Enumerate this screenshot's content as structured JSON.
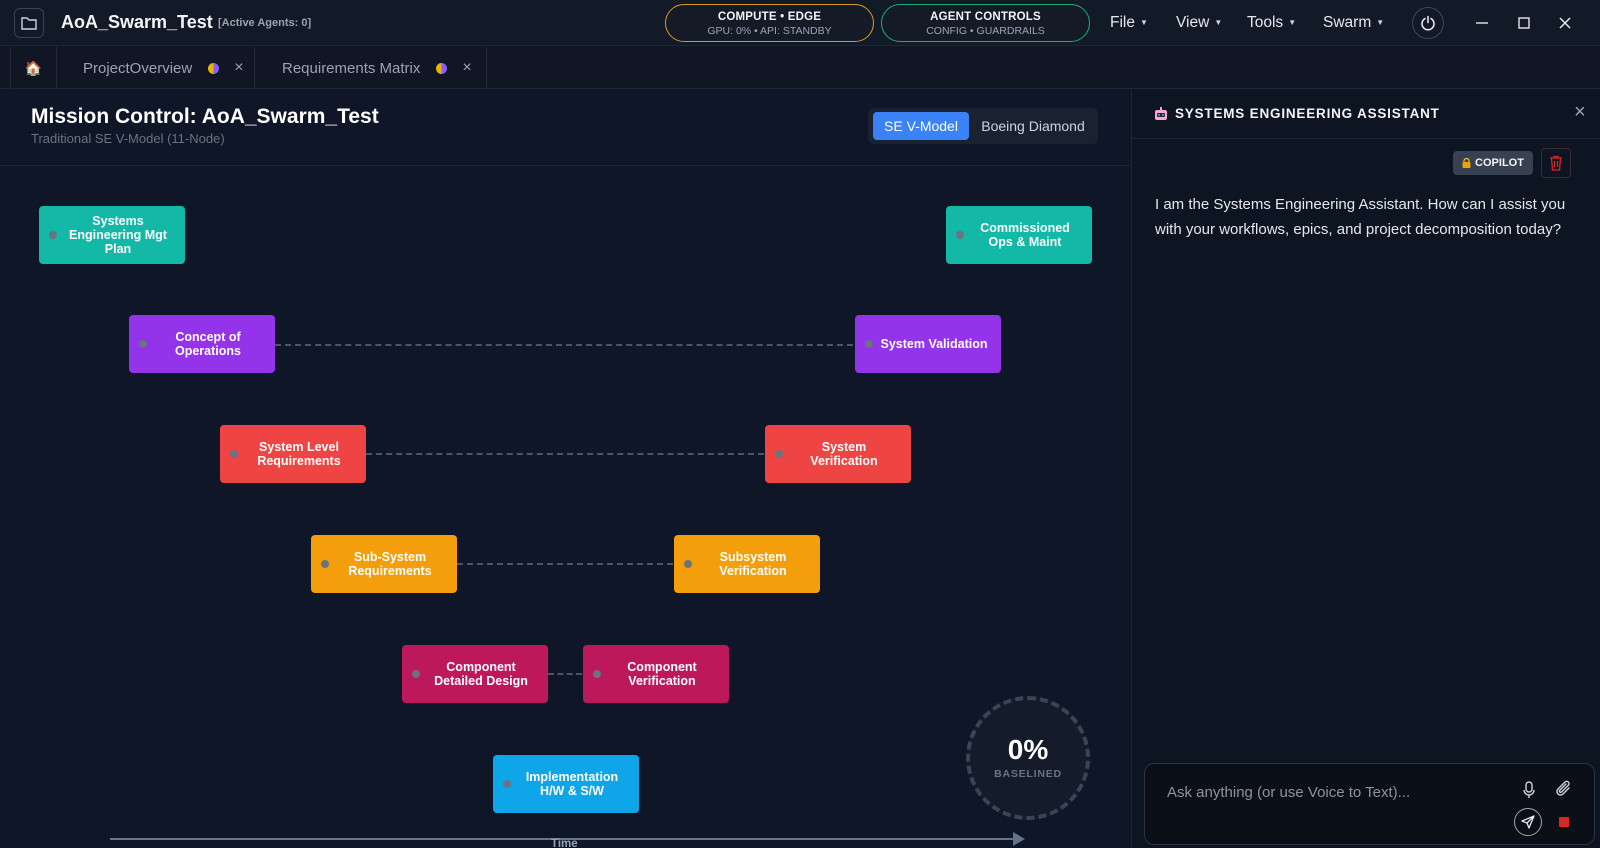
{
  "titlebar": {
    "app_title": "AoA_Swarm_Test",
    "active_agents": "[Active Agents: 0]",
    "compute_pill": {
      "line1": "COMPUTE • EDGE",
      "line2": "GPU: 0% • API: STANDBY",
      "accent": "#d69a2a"
    },
    "agent_pill": {
      "line1": "AGENT CONTROLS",
      "line2": "CONFIG • GUARDRAILS",
      "accent": "#22a77a"
    },
    "menus": [
      "File",
      "View",
      "Tools",
      "Swarm"
    ],
    "icons": [
      "folder-icon",
      "power-icon",
      "minimize-icon",
      "maximize-icon",
      "close-icon"
    ]
  },
  "tabs": [
    {
      "label": "ProjectOverview"
    },
    {
      "label": "Requirements Matrix"
    }
  ],
  "main": {
    "title": "Mission Control: AoA_Swarm_Test",
    "subtitle": "Traditional SE V-Model (11-Node)",
    "view_toggle": {
      "active": "SE V-Model",
      "inactive": "Boeing Diamond",
      "active_color": "#3b82f6"
    },
    "nodes": [
      {
        "label": "Systems Engineering Mgt Plan",
        "color": "#14b8a6"
      },
      {
        "label": "Concept of Operations",
        "color": "#9333ea"
      },
      {
        "label": "System Level Requirements",
        "color": "#ef4444"
      },
      {
        "label": "Sub-System Requirements",
        "color": "#f59e0b"
      },
      {
        "label": "Component Detailed Design",
        "color": "#be185d"
      },
      {
        "label": "Implementation H/W & S/W",
        "color": "#0ea5e9"
      },
      {
        "label": "Component Verification",
        "color": "#be185d"
      },
      {
        "label": "Subsystem Verification",
        "color": "#f59e0b"
      },
      {
        "label": "System Verification",
        "color": "#ef4444"
      },
      {
        "label": "System Validation",
        "color": "#9333ea"
      },
      {
        "label": "Commissioned Ops & Maint",
        "color": "#14b8a6"
      }
    ],
    "gauge": {
      "value": "0%",
      "label": "BASELINED",
      "progress": 0
    },
    "axis_label": "Time"
  },
  "assistant": {
    "title": "SYSTEMS ENGINEERING ASSISTANT",
    "copilot_badge": "COPILOT",
    "message": "I am the Systems Engineering Assistant. How can I assist you with your workflows, epics, and project decomposition today?",
    "input_placeholder": "Ask anything (or use Voice to Text)...",
    "icons": [
      "robot-icon",
      "close-icon",
      "lock-icon",
      "trash-icon",
      "mic-icon",
      "paperclip-icon",
      "send-icon",
      "stop-icon"
    ]
  }
}
